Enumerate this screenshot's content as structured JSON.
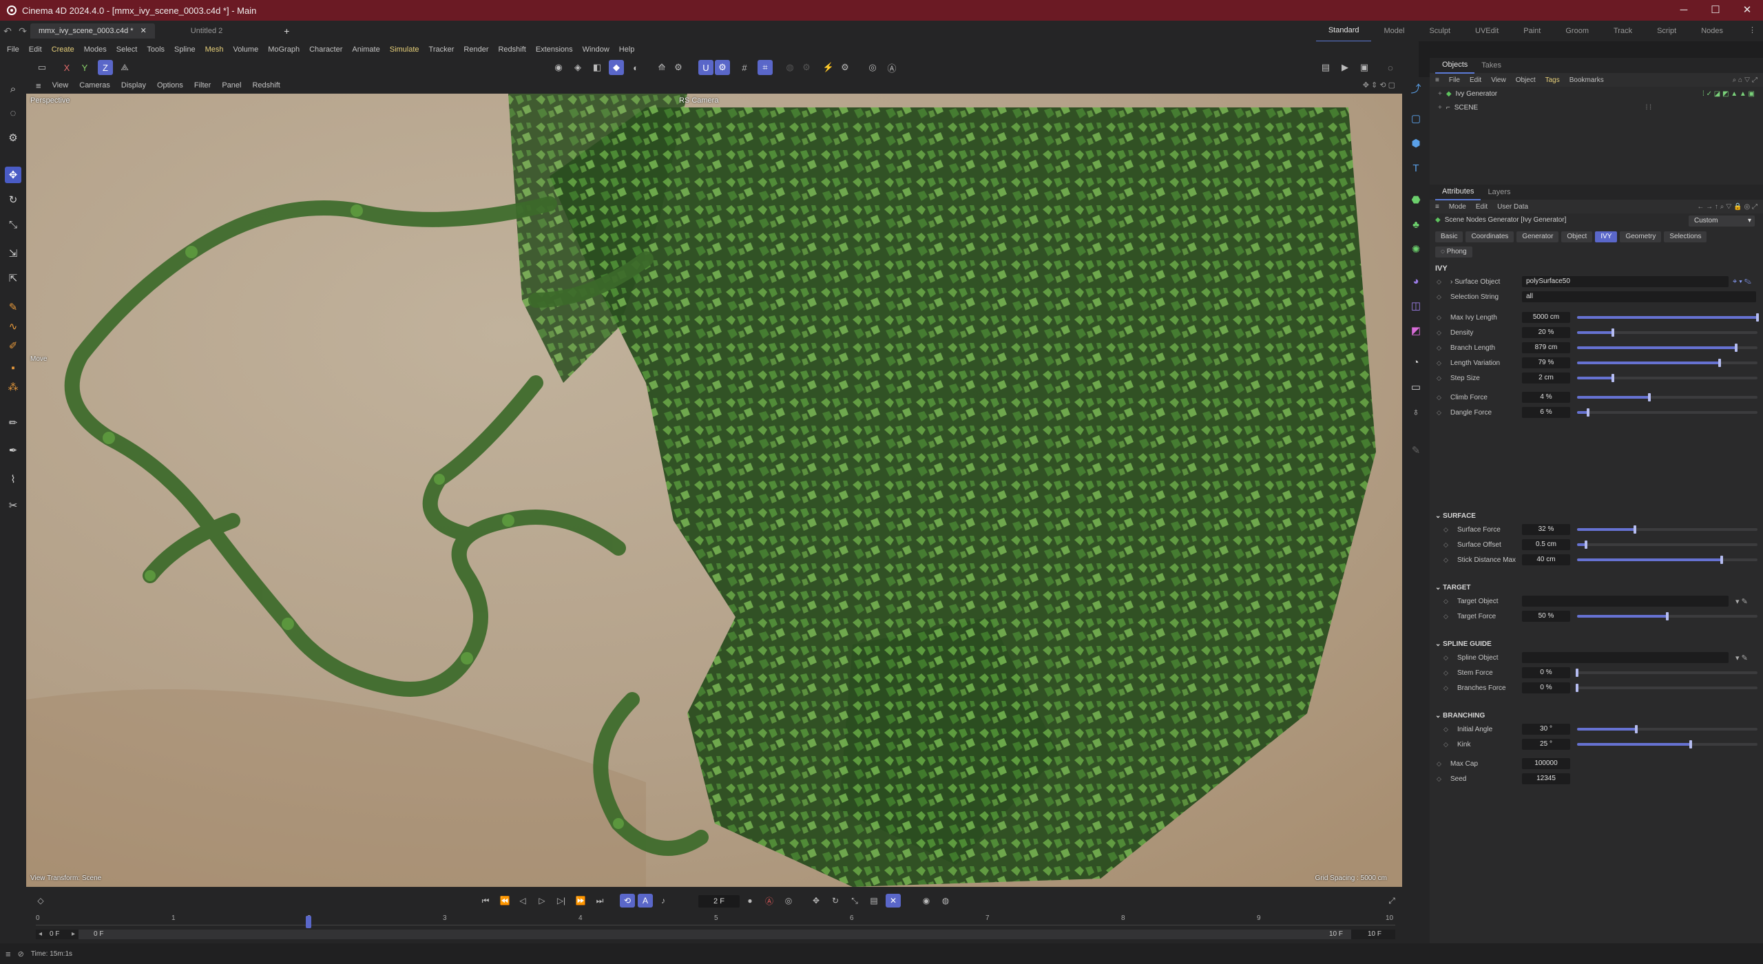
{
  "window": {
    "title": "Cinema 4D 2024.4.0 - [mmx_ivy_scene_0003.c4d *] - Main"
  },
  "tabs": {
    "doc1": "mmx_ivy_scene_0003.c4d *",
    "doc2": "Untitled 2",
    "add": "+"
  },
  "layouts": [
    "Standard",
    "Model",
    "Sculpt",
    "UVEdit",
    "Paint",
    "Groom",
    "Track",
    "Script",
    "Nodes"
  ],
  "menu": [
    "File",
    "Edit",
    "Create",
    "Modes",
    "Select",
    "Tools",
    "Spline",
    "Mesh",
    "Volume",
    "MoGraph",
    "Character",
    "Animate",
    "Simulate",
    "Tracker",
    "Render",
    "Redshift",
    "Extensions",
    "Window",
    "Help"
  ],
  "toolbar_axes": {
    "x": "X",
    "y": "Y",
    "z": "Z"
  },
  "viewport": {
    "menu": [
      "View",
      "Cameras",
      "Display",
      "Options",
      "Filter",
      "Panel",
      "Redshift"
    ],
    "projection": "Perspective",
    "camera": "RS Camera",
    "tool_hint": "Move",
    "view_transform": "View Transform: Scene",
    "grid_spacing": "Grid Spacing : 5000 cm"
  },
  "timeline": {
    "current_frame": "2 F",
    "start_field": "0 F",
    "start_field2": "0 F",
    "end_field": "10 F",
    "end_field2": "10 F",
    "ticks": [
      "0",
      "1",
      "2",
      "3",
      "4",
      "5",
      "6",
      "7",
      "8",
      "9",
      "10"
    ],
    "playhead_frame": 2
  },
  "status": {
    "time": "Time: 15m:1s"
  },
  "objects": {
    "tabs": [
      "Objects",
      "Takes"
    ],
    "menu": [
      "File",
      "Edit",
      "View",
      "Object",
      "Tags",
      "Bookmarks"
    ],
    "items": [
      {
        "name": "Ivy Generator"
      },
      {
        "name": "SCENE"
      }
    ]
  },
  "attributes": {
    "tabs": [
      "Attributes",
      "Layers"
    ],
    "menu": [
      "Mode",
      "Edit",
      "User Data"
    ],
    "object_title": "Scene Nodes Generator [Ivy Generator]",
    "preset": "Custom",
    "attr_tabs": [
      "Basic",
      "Coordinates",
      "Generator",
      "Object",
      "IVY",
      "Geometry",
      "Selections"
    ],
    "phong_tab": "Phong",
    "section_main": "IVY",
    "surface_object": {
      "label": "Surface Object",
      "value": "polySurface50"
    },
    "selection_string": {
      "label": "Selection String",
      "value": "all"
    },
    "params": [
      {
        "label": "Max Ivy Length",
        "value": "5000 cm",
        "fraction": 1.0
      },
      {
        "label": "Density",
        "value": "20 %",
        "fraction": 0.2
      },
      {
        "label": "Branch Length",
        "value": "879 cm",
        "fraction": 0.88
      },
      {
        "label": "Length Variation",
        "value": "79 %",
        "fraction": 0.79
      },
      {
        "label": "Step Size",
        "value": "2 cm",
        "fraction": 0.2
      },
      {
        "label": "Climb Force",
        "value": "4 %",
        "fraction": 0.4
      },
      {
        "label": "Dangle Force",
        "value": "6 %",
        "fraction": 0.06
      }
    ],
    "surface": {
      "title": "SURFACE",
      "params": [
        {
          "label": "Surface Force",
          "value": "32 %",
          "fraction": 0.32
        },
        {
          "label": "Surface Offset",
          "value": "0.5 cm",
          "fraction": 0.05
        },
        {
          "label": "Stick Distance Max",
          "value": "40 cm",
          "fraction": 0.8
        }
      ]
    },
    "target": {
      "title": "TARGET",
      "object_label": "Target Object",
      "params": [
        {
          "label": "Target Force",
          "value": "50 %",
          "fraction": 0.5
        }
      ]
    },
    "spline_guide": {
      "title": "SPLINE GUIDE",
      "object_label": "Spline Object",
      "params": [
        {
          "label": "Stem Force",
          "value": "0 %",
          "fraction": 0.0
        },
        {
          "label": "Branches Force",
          "value": "0 %",
          "fraction": 0.0
        }
      ]
    },
    "branching": {
      "title": "BRANCHING",
      "params": [
        {
          "label": "Initial Angle",
          "value": "30 °",
          "fraction": 0.33
        },
        {
          "label": "Kink",
          "value": "25 °",
          "fraction": 0.63
        }
      ]
    },
    "max_cap": {
      "label": "Max Cap",
      "value": "100000"
    },
    "seed": {
      "label": "Seed",
      "value": "12345"
    }
  },
  "colors": {
    "titlebar": "#6b1a24",
    "accent": "#5a67c9",
    "wall": "#b7a58e",
    "ivy_dark": "#2f5a23",
    "ivy_light": "#5d9a3e"
  }
}
